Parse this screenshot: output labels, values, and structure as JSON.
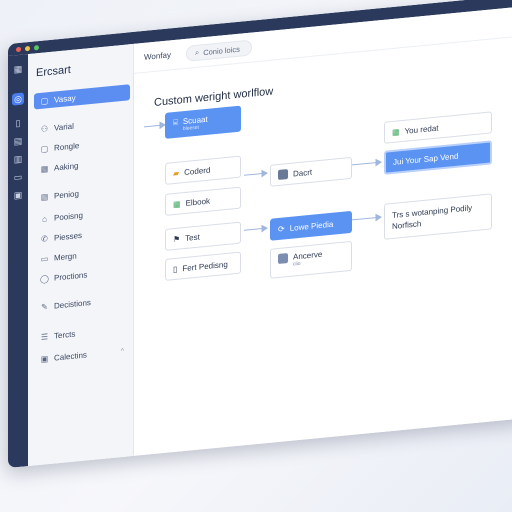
{
  "window": {
    "brand": "Ercsart"
  },
  "topbar": {
    "crumb": "Wonfay",
    "search_label": "Conio loics"
  },
  "sidebar": {
    "items": [
      {
        "label": "Vasay",
        "icon": "folder-icon",
        "glyph": "▢",
        "active": true
      },
      {
        "label": "Varial",
        "icon": "people-icon",
        "glyph": "⚇"
      },
      {
        "label": "Rongle",
        "icon": "box-icon",
        "glyph": "▢"
      },
      {
        "label": "Aaking",
        "icon": "grid-icon",
        "glyph": "▦"
      },
      {
        "label": "Peniog",
        "icon": "calendar-icon",
        "glyph": "▤"
      },
      {
        "label": "Pooisng",
        "icon": "tag-icon",
        "glyph": "⌂"
      },
      {
        "label": "Piesses",
        "icon": "phone-icon",
        "glyph": "✆"
      },
      {
        "label": "Mergn",
        "icon": "chat-icon",
        "glyph": "▭"
      },
      {
        "label": "Proctions",
        "icon": "shield-icon",
        "glyph": "◯"
      },
      {
        "label": "Decistions",
        "icon": "pen-icon",
        "glyph": "✎"
      },
      {
        "label": "Tercts",
        "icon": "list-icon",
        "glyph": "☰"
      },
      {
        "label": "Calectins",
        "icon": "image-icon",
        "glyph": "▣",
        "chevron": "^"
      }
    ]
  },
  "canvas": {
    "title": "Custom weright worlflow",
    "nodes": {
      "start": {
        "label": "Scuaat",
        "sub": "bleeset",
        "icon": "doc-icon",
        "glyph": "⌸"
      },
      "coderd": {
        "label": "Coderd",
        "icon": "folder-icon",
        "glyph": "▰"
      },
      "elbook": {
        "label": "Elbook",
        "icon": "sheet-icon",
        "glyph": "▦"
      },
      "dacrt": {
        "label": "Dacrt",
        "icon": "avatar-icon"
      },
      "test": {
        "label": "Test",
        "icon": "flag-icon",
        "glyph": "⚑"
      },
      "fert": {
        "label": "Fert Pedisng",
        "icon": "doc-icon",
        "glyph": "▯"
      },
      "lowe": {
        "label": "Lowe Piedia",
        "icon": "refresh-icon",
        "glyph": "⟳"
      },
      "ancerve": {
        "label": "Ancerve",
        "sub": "clio",
        "icon": "avatar-icon"
      },
      "you_redat": {
        "label": "You redat",
        "icon": "sheet-icon",
        "glyph": "▦"
      },
      "your_sep": {
        "label": "Jui Your Sap Vend"
      },
      "result": {
        "line1": "Trs s wotanping Podily",
        "line2": "Norfisch"
      }
    }
  }
}
